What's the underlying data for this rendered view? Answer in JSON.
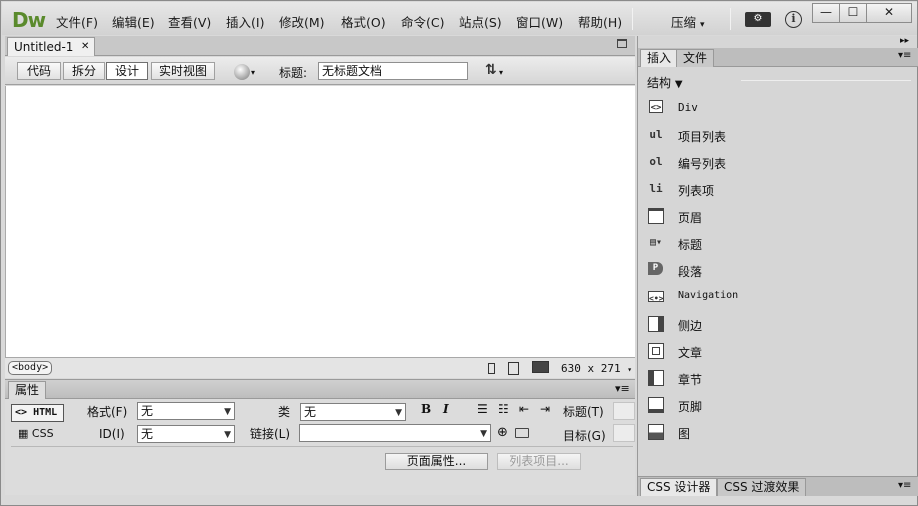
{
  "app": {
    "logo": "Dw"
  },
  "menu": [
    "文件(F)",
    "编辑(E)",
    "查看(V)",
    "插入(I)",
    "修改(M)",
    "格式(O)",
    "命令(C)",
    "站点(S)",
    "窗口(W)",
    "帮助(H)"
  ],
  "workspace": {
    "label": "压缩",
    "arrow": "▾"
  },
  "window_controls": {
    "minimize": "—",
    "maximize": "☐",
    "close": "✕"
  },
  "document": {
    "tab_label": "Untitled-1",
    "tab_close": "✕",
    "views": [
      "代码",
      "拆分",
      "设计",
      "实时视图"
    ],
    "title_label": "标题:",
    "title_value": "无标题文档",
    "status_tag": "<body>",
    "dimensions": "630 x 271"
  },
  "properties": {
    "header": "属性",
    "html_button": "HTML",
    "css_button": "CSS",
    "format_label": "格式(F)",
    "format_value": "无",
    "id_label": "ID(I)",
    "id_value": "无",
    "class_label": "类",
    "class_value": "无",
    "link_label": "链接(L)",
    "link_value": "",
    "bold": "B",
    "italic": "I",
    "heading_label": "标题(T)",
    "target_label": "目标(G)",
    "page_props": "页面属性...",
    "list_item": "列表项目..."
  },
  "panel": {
    "tabs": [
      "插入",
      "文件"
    ],
    "category": "结构",
    "items": [
      {
        "icon": "<>",
        "label": "Div"
      },
      {
        "icon": "ul",
        "label": "项目列表"
      },
      {
        "icon": "ol",
        "label": "编号列表"
      },
      {
        "icon": "li",
        "label": "列表项"
      },
      {
        "icon": "header-icon",
        "label": "页眉"
      },
      {
        "icon": "heading-icon",
        "label": "标题"
      },
      {
        "icon": "P",
        "label": "段落"
      },
      {
        "icon": "<•>",
        "label": "Navigation"
      },
      {
        "icon": "aside-icon",
        "label": "侧边"
      },
      {
        "icon": "article-icon",
        "label": "文章"
      },
      {
        "icon": "section-icon",
        "label": "章节"
      },
      {
        "icon": "footer-icon",
        "label": "页脚"
      },
      {
        "icon": "figure-icon",
        "label": "图"
      }
    ],
    "bottom_tabs": [
      "CSS 设计器",
      "CSS 过渡效果"
    ]
  }
}
